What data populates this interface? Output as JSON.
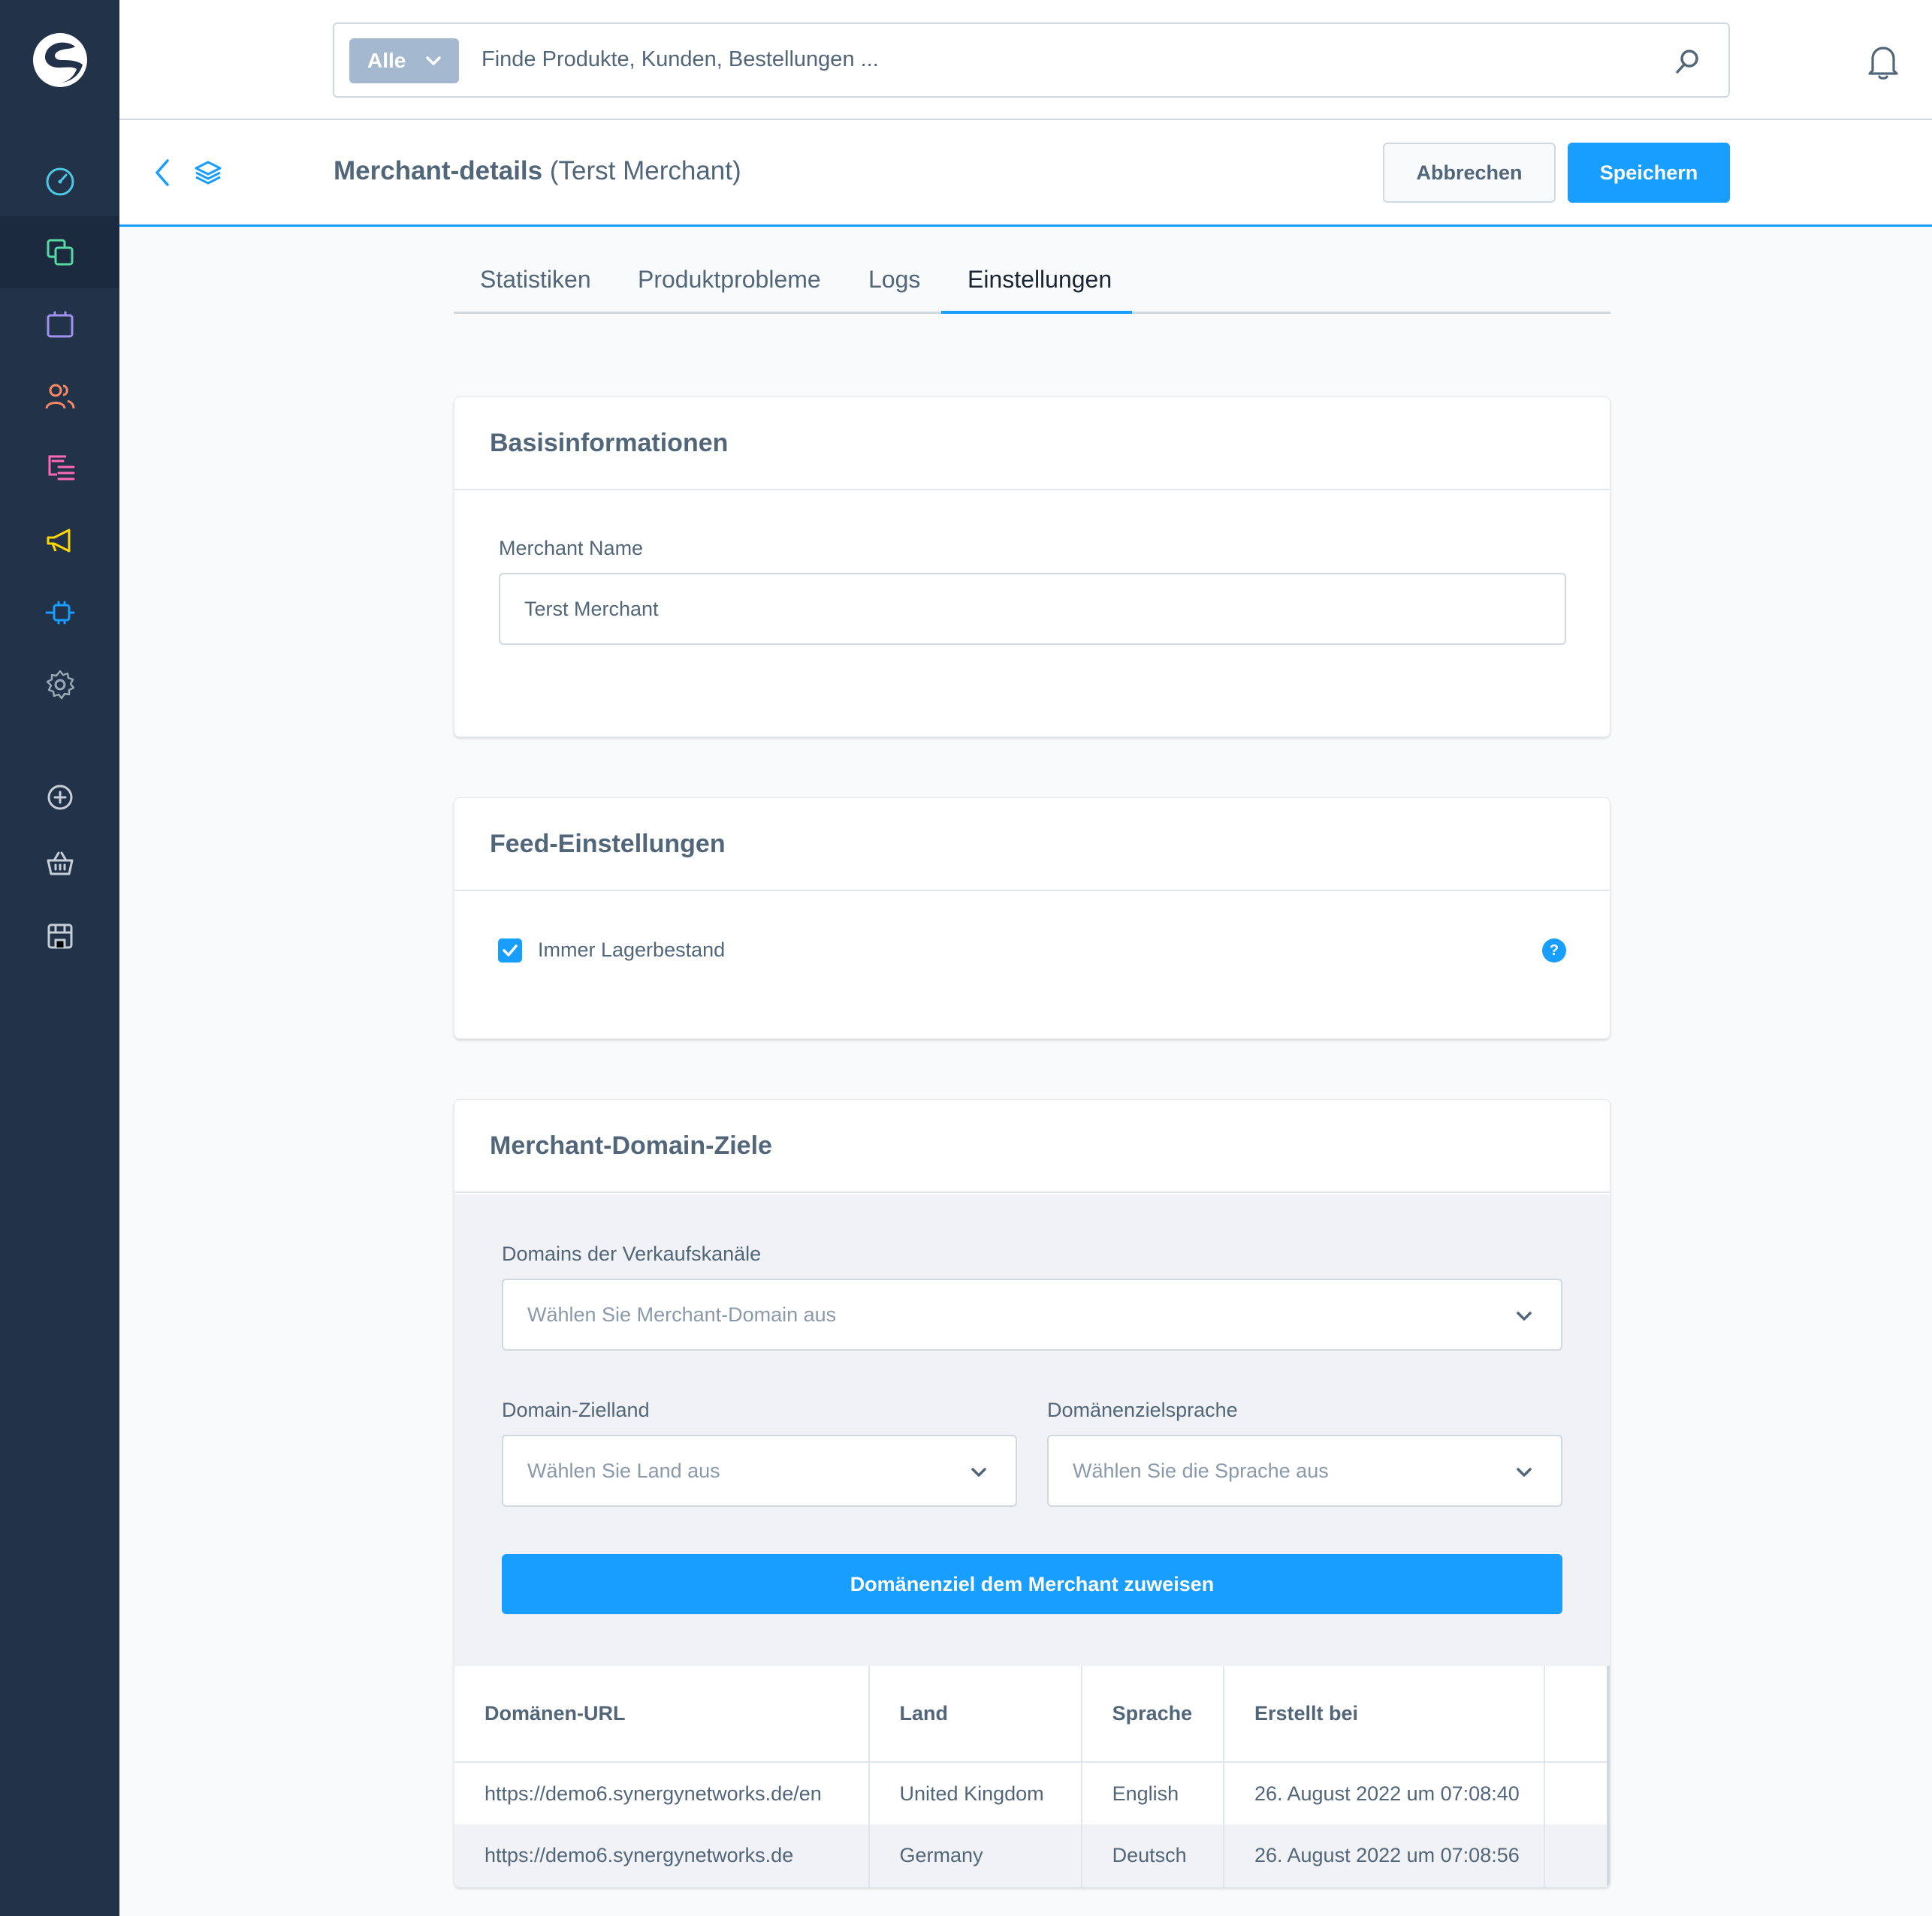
{
  "search": {
    "type_label": "Alle",
    "placeholder": "Finde Produkte, Kunden, Bestellungen ..."
  },
  "smartbar": {
    "title": "Merchant-details",
    "subtitle": "(Terst Merchant)",
    "cancel_label": "Abbrechen",
    "save_label": "Speichern"
  },
  "tabs": [
    {
      "label": "Statistiken"
    },
    {
      "label": "Produktprobleme"
    },
    {
      "label": "Logs"
    },
    {
      "label": "Einstellungen"
    }
  ],
  "basis": {
    "title": "Basisinformationen",
    "name_label": "Merchant Name",
    "name_value": "Terst Merchant"
  },
  "feed": {
    "title": "Feed-Einstellungen",
    "checkbox_label": "Immer Lagerbestand",
    "help_icon_text": "?"
  },
  "domains": {
    "title": "Merchant-Domain-Ziele",
    "channel_label": "Domains der Verkaufskanäle",
    "channel_placeholder": "Wählen Sie Merchant-Domain aus",
    "country_label": "Domain-Zielland",
    "country_placeholder": "Wählen Sie Land aus",
    "language_label": "Domänenzielsprache",
    "language_placeholder": "Wählen Sie die Sprache aus",
    "assign_label": "Domänenziel dem Merchant zuweisen",
    "columns": [
      "Domänen-URL",
      "Land",
      "Sprache",
      "Erstellt bei"
    ],
    "rows": [
      [
        "https://demo6.synergynetworks.de/en",
        "United Kingdom",
        "English",
        "26. August 2022 um 07:08:40"
      ],
      [
        "https://demo6.synergynetworks.de",
        "Germany",
        "Deutsch",
        "26. August 2022 um 07:08:56"
      ]
    ]
  },
  "colors": {
    "sidebar": "#223249",
    "accent": "#189eff",
    "text": "#52667a"
  },
  "icons": {
    "nav": [
      "dashboard-icon",
      "catalog-icon",
      "orders-icon",
      "customers-icon",
      "content-icon",
      "marketing-icon",
      "extensions-icon",
      "settings-icon",
      "add-channel-icon",
      "storefront-basket-icon",
      "shop-icon"
    ]
  }
}
